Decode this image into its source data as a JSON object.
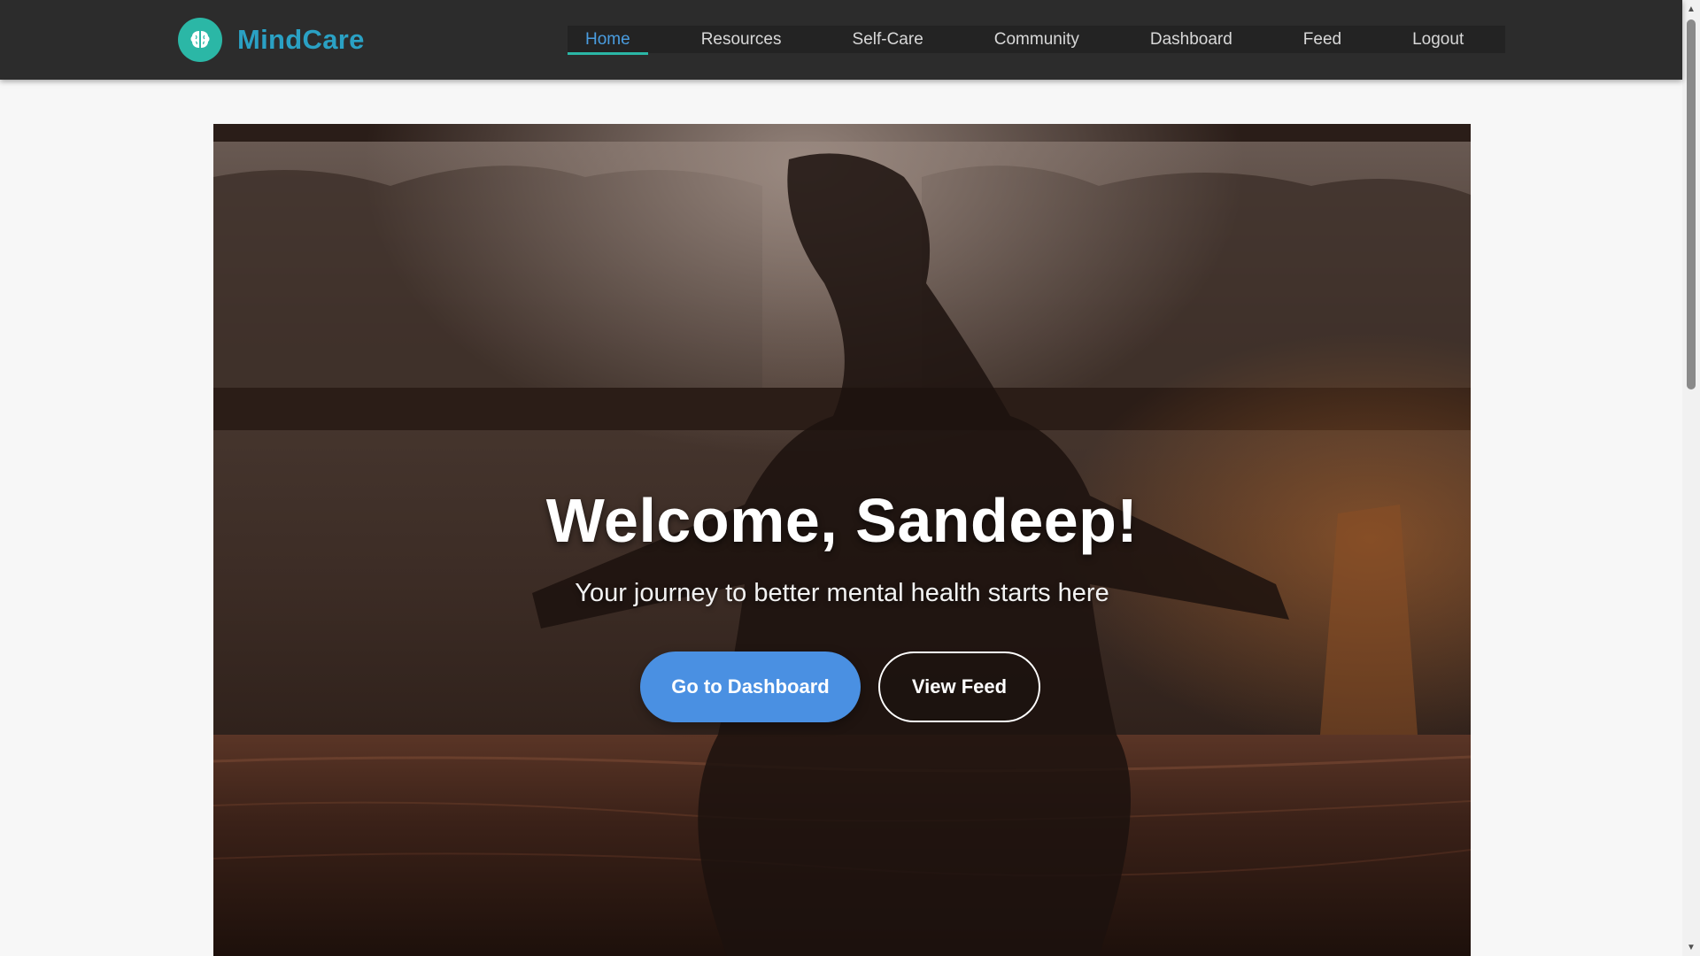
{
  "brand": {
    "name": "MindCare",
    "logo_icon": "brain-icon",
    "color": "#2aa1c4",
    "logo_color": "#2bb7a6"
  },
  "nav": {
    "items": [
      {
        "label": "Home",
        "active": true
      },
      {
        "label": "Resources",
        "active": false
      },
      {
        "label": "Self-Care",
        "active": false
      },
      {
        "label": "Community",
        "active": false
      },
      {
        "label": "Dashboard",
        "active": false
      },
      {
        "label": "Feed",
        "active": false
      },
      {
        "label": "Logout",
        "active": false
      }
    ],
    "active_color": "#4a9de0",
    "underline_color": "#2bb7a6"
  },
  "hero": {
    "title": "Welcome, Sandeep!",
    "subtitle": "Your journey to better mental health starts here",
    "primary_button": "Go to Dashboard",
    "secondary_button": "View Feed",
    "primary_color": "#4a90e2",
    "background": "meditation-silhouette-photo"
  }
}
